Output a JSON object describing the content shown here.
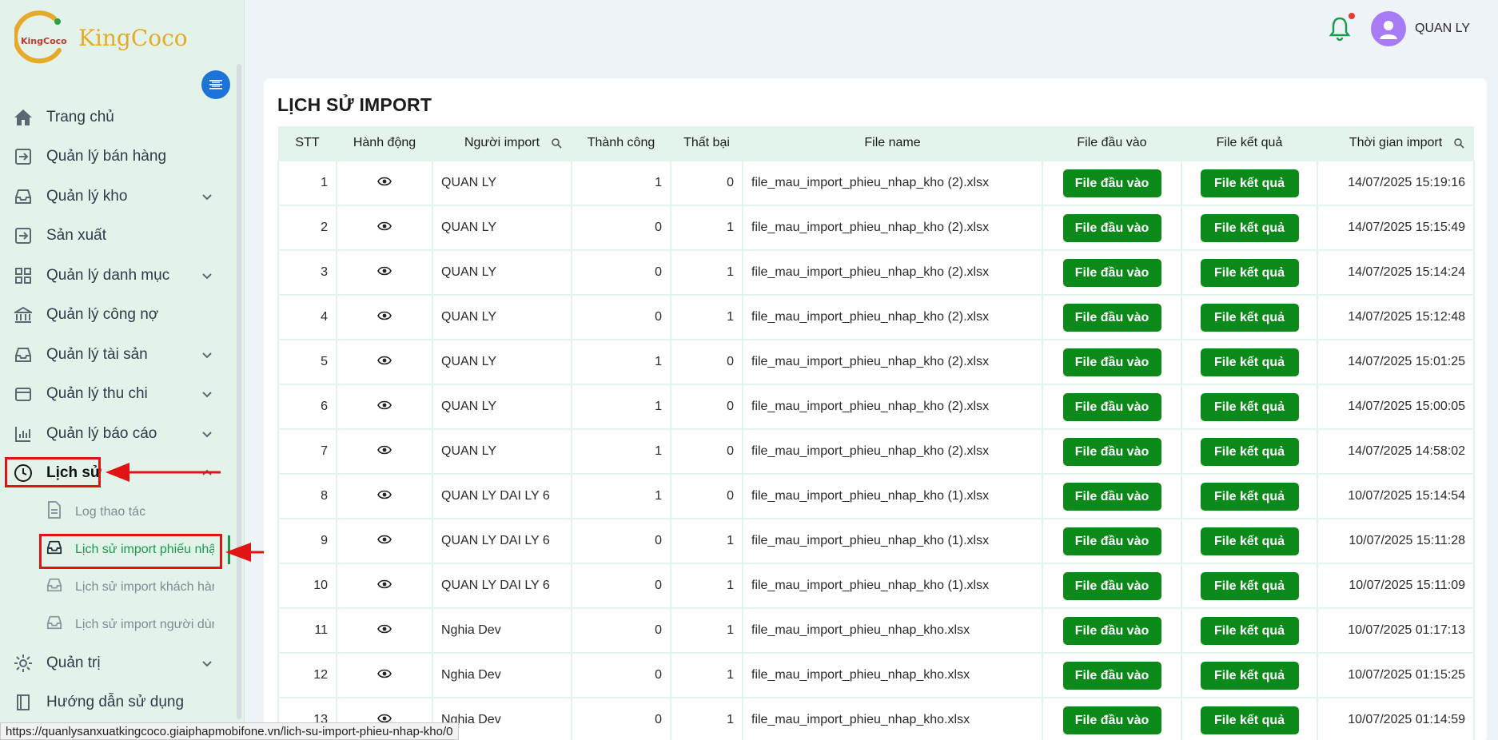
{
  "brand": {
    "logo_text": "KingCoco",
    "mark_text": "KingCoco"
  },
  "header": {
    "username": "QUAN LY"
  },
  "sidebar": {
    "items": [
      {
        "label": "Trang chủ",
        "icon": "home-icon"
      },
      {
        "label": "Quản lý bán hàng",
        "icon": "sales-icon"
      },
      {
        "label": "Quản lý kho",
        "icon": "inbox-icon"
      },
      {
        "label": "Sản xuất",
        "icon": "production-icon"
      },
      {
        "label": "Quản lý danh mục",
        "icon": "grid-icon"
      },
      {
        "label": "Quản lý công nợ",
        "icon": "bank-icon"
      },
      {
        "label": "Quản lý tài sản",
        "icon": "inbox-icon"
      },
      {
        "label": "Quản lý thu chi",
        "icon": "wallet-icon"
      },
      {
        "label": "Quản lý báo cáo",
        "icon": "bar-chart-icon"
      },
      {
        "label": "Lịch sử",
        "icon": "clock-icon"
      }
    ],
    "sub_items": [
      {
        "label": "Log thao tác",
        "icon": "file-icon"
      },
      {
        "label": "Lịch sử import phiếu nhập kho",
        "icon": "inbox-icon"
      },
      {
        "label": "Lịch sử import khách hàng",
        "icon": "inbox-icon"
      },
      {
        "label": "Lịch sử import người dùng",
        "icon": "inbox-icon"
      }
    ],
    "bottom_items": [
      {
        "label": "Quản trị",
        "icon": "gear-icon"
      },
      {
        "label": "Hướng dẫn sử dụng",
        "icon": "book-icon"
      }
    ]
  },
  "page": {
    "title": "LỊCH SỬ IMPORT",
    "columns": [
      "STT",
      "Hành động",
      "Người import",
      "Thành công",
      "Thất bại",
      "File name",
      "File đầu vào",
      "File kết quả",
      "Thời gian import"
    ],
    "btn_input": "File đầu vào",
    "btn_result": "File kết quả",
    "rows": [
      {
        "stt": "1",
        "user": "QUAN LY",
        "ok": "1",
        "fail": "0",
        "file": "file_mau_import_phieu_nhap_kho (2).xlsx",
        "time": "14/07/2025 15:19:16"
      },
      {
        "stt": "2",
        "user": "QUAN LY",
        "ok": "0",
        "fail": "1",
        "file": "file_mau_import_phieu_nhap_kho (2).xlsx",
        "time": "14/07/2025 15:15:49"
      },
      {
        "stt": "3",
        "user": "QUAN LY",
        "ok": "0",
        "fail": "1",
        "file": "file_mau_import_phieu_nhap_kho (2).xlsx",
        "time": "14/07/2025 15:14:24"
      },
      {
        "stt": "4",
        "user": "QUAN LY",
        "ok": "0",
        "fail": "1",
        "file": "file_mau_import_phieu_nhap_kho (2).xlsx",
        "time": "14/07/2025 15:12:48"
      },
      {
        "stt": "5",
        "user": "QUAN LY",
        "ok": "1",
        "fail": "0",
        "file": "file_mau_import_phieu_nhap_kho (2).xlsx",
        "time": "14/07/2025 15:01:25"
      },
      {
        "stt": "6",
        "user": "QUAN LY",
        "ok": "1",
        "fail": "0",
        "file": "file_mau_import_phieu_nhap_kho (2).xlsx",
        "time": "14/07/2025 15:00:05"
      },
      {
        "stt": "7",
        "user": "QUAN LY",
        "ok": "1",
        "fail": "0",
        "file": "file_mau_import_phieu_nhap_kho (2).xlsx",
        "time": "14/07/2025 14:58:02"
      },
      {
        "stt": "8",
        "user": "QUAN LY DAI LY 6",
        "ok": "1",
        "fail": "0",
        "file": "file_mau_import_phieu_nhap_kho (1).xlsx",
        "time": "10/07/2025 15:14:54"
      },
      {
        "stt": "9",
        "user": "QUAN LY DAI LY 6",
        "ok": "0",
        "fail": "1",
        "file": "file_mau_import_phieu_nhap_kho (1).xlsx",
        "time": "10/07/2025 15:11:28"
      },
      {
        "stt": "10",
        "user": "QUAN LY DAI LY 6",
        "ok": "0",
        "fail": "1",
        "file": "file_mau_import_phieu_nhap_kho (1).xlsx",
        "time": "10/07/2025 15:11:09"
      },
      {
        "stt": "11",
        "user": "Nghia Dev",
        "ok": "0",
        "fail": "1",
        "file": "file_mau_import_phieu_nhap_kho.xlsx",
        "time": "10/07/2025 01:17:13"
      },
      {
        "stt": "12",
        "user": "Nghia Dev",
        "ok": "0",
        "fail": "1",
        "file": "file_mau_import_phieu_nhap_kho.xlsx",
        "time": "10/07/2025 01:15:25"
      },
      {
        "stt": "13",
        "user": "Nghia Dev",
        "ok": "0",
        "fail": "1",
        "file": "file_mau_import_phieu_nhap_kho.xlsx",
        "time": "10/07/2025 01:14:59"
      }
    ]
  },
  "statusbar": {
    "url": "https://quanlysanxuatkingcoco.giaiphapmobifone.vn/lich-su-import-phieu-nhap-kho/0"
  },
  "colors": {
    "accent_green": "#0b8a1a",
    "sidebar_bg": "#e3f3ea",
    "highlight_red": "#e01414",
    "avatar": "#a77bf3"
  }
}
